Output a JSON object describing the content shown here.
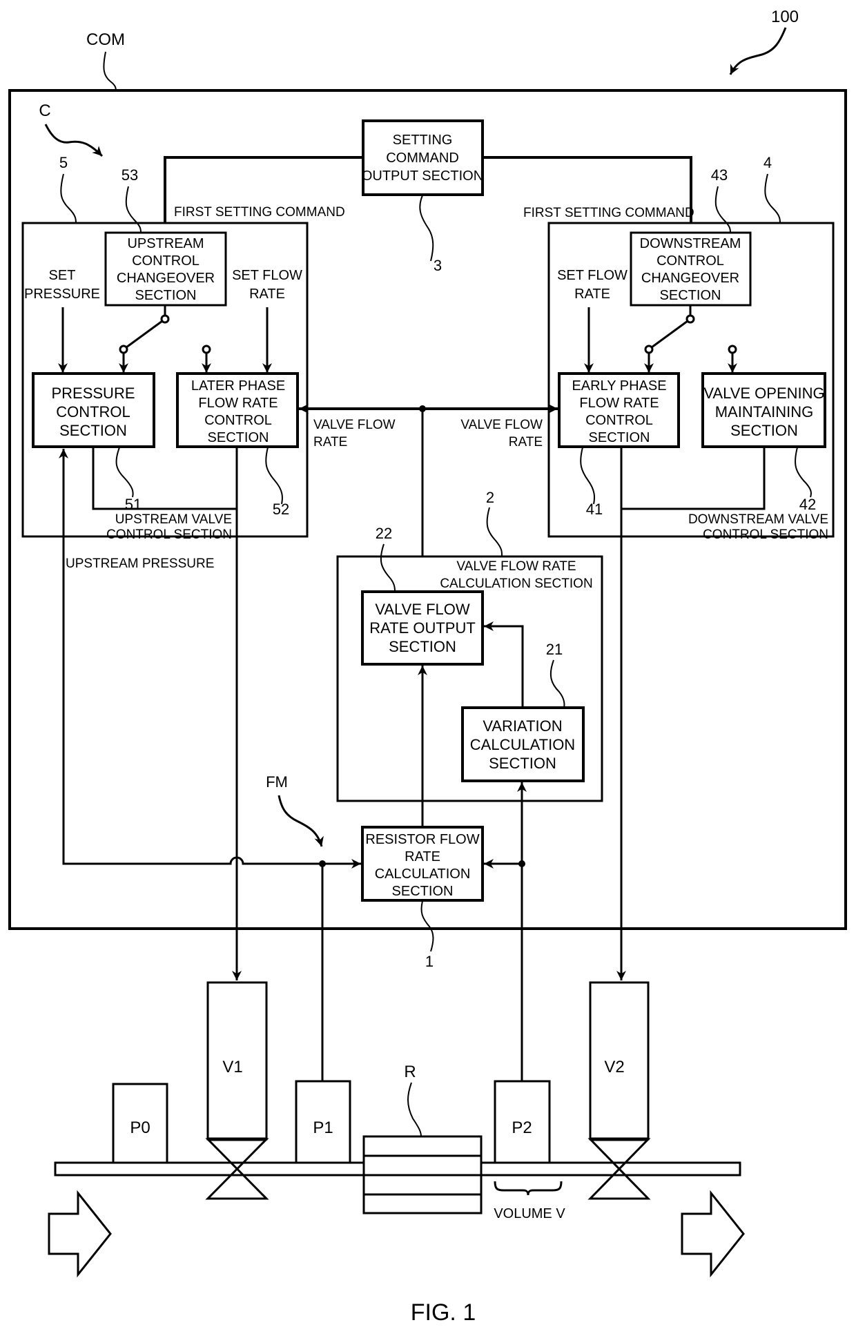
{
  "figure": {
    "caption": "FIG. 1",
    "ref_system": "100",
    "ref_com": "COM",
    "ref_controller": "C",
    "ref_flow_meter": "FM"
  },
  "blocks": {
    "setting_command": {
      "lines": [
        "SETTING",
        "COMMAND",
        "OUTPUT SECTION"
      ],
      "ref": "3"
    },
    "upstream_valve_control": {
      "lines": [
        "UPSTREAM VALVE",
        "CONTROL SECTION"
      ],
      "ref": "5"
    },
    "upstream_changeover": {
      "lines": [
        "UPSTREAM",
        "CONTROL",
        "CHANGEOVER",
        "SECTION"
      ],
      "ref": "53"
    },
    "pressure_control": {
      "lines": [
        "PRESSURE",
        "CONTROL",
        "SECTION"
      ],
      "ref": "51"
    },
    "later_phase": {
      "lines": [
        "LATER PHASE",
        "FLOW RATE",
        "CONTROL",
        "SECTION"
      ],
      "ref": "52"
    },
    "downstream_valve_control": {
      "lines": [
        "DOWNSTREAM VALVE",
        "CONTROL SECTION"
      ],
      "ref": "4"
    },
    "downstream_changeover": {
      "lines": [
        "DOWNSTREAM",
        "CONTROL",
        "CHANGEOVER",
        "SECTION"
      ],
      "ref": "43"
    },
    "early_phase": {
      "lines": [
        "EARLY PHASE",
        "FLOW RATE",
        "CONTROL",
        "SECTION"
      ],
      "ref": "41"
    },
    "valve_opening": {
      "lines": [
        "VALVE OPENING",
        "MAINTAINING",
        "SECTION"
      ],
      "ref": "42"
    },
    "valve_flow_calc": {
      "lines": [
        "VALVE FLOW RATE",
        "CALCULATION SECTION"
      ],
      "ref": "2"
    },
    "valve_flow_output": {
      "lines": [
        "VALVE FLOW",
        "RATE OUTPUT",
        "SECTION"
      ],
      "ref": "22"
    },
    "variation_calc": {
      "lines": [
        "VARIATION",
        "CALCULATION",
        "SECTION"
      ],
      "ref": "21"
    },
    "resistor_flow_calc": {
      "lines": [
        "RESISTOR FLOW",
        "RATE",
        "CALCULATION",
        "SECTION"
      ],
      "ref": "1"
    }
  },
  "signals": {
    "first_setting_command_left": "FIRST SETTING COMMAND",
    "first_setting_command_right": "FIRST SETTING COMMAND",
    "set_pressure": [
      "SET",
      "PRESSURE"
    ],
    "set_flow_rate_left": [
      "SET FLOW",
      "RATE"
    ],
    "set_flow_rate_right": [
      "SET FLOW",
      "RATE"
    ],
    "valve_flow_rate_left": [
      "VALVE FLOW",
      "RATE"
    ],
    "valve_flow_rate_right": [
      "VALVE FLOW",
      "RATE"
    ],
    "upstream_pressure": "UPSTREAM PRESSURE"
  },
  "hardware": {
    "p0": "P0",
    "v1": "V1",
    "p1": "P1",
    "resistor": "R",
    "p2": "P2",
    "v2": "V2",
    "volume": "VOLUME V"
  }
}
